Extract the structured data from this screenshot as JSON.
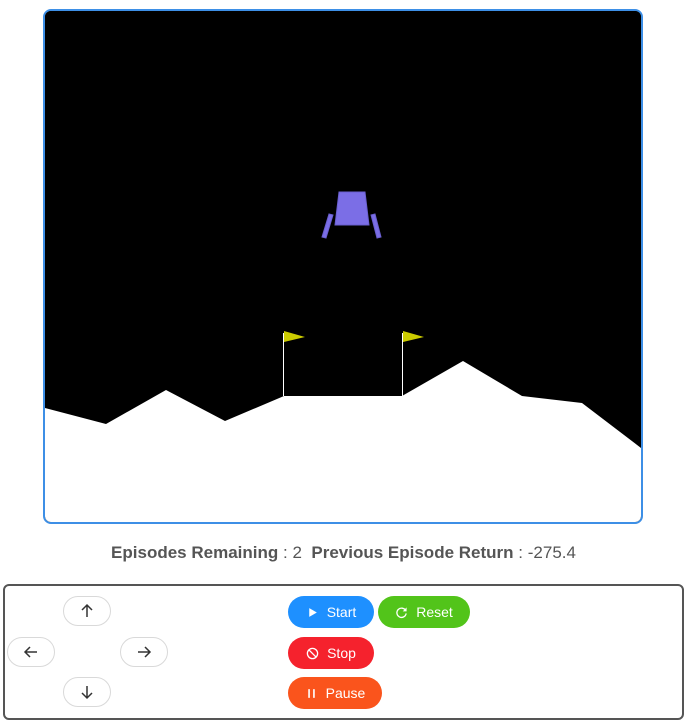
{
  "game": {
    "sky_color": "#000000",
    "ground_color": "#ffffff",
    "lander_color": "#7b6ee6",
    "flag_color": "#cccc00"
  },
  "stats": {
    "episodes_label": "Episodes Remaining",
    "episodes_value": "2",
    "return_label": "Previous Episode Return",
    "return_value": "-275.4",
    "separator": ":"
  },
  "controls": {
    "arrows": {
      "up": "arrow-up-icon",
      "left": "arrow-left-icon",
      "right": "arrow-right-icon",
      "down": "arrow-down-icon"
    },
    "start_label": "Start",
    "reset_label": "Reset",
    "stop_label": "Stop",
    "pause_label": "Pause",
    "colors": {
      "start": "#1e90ff",
      "reset": "#52c41a",
      "stop": "#f5222d",
      "pause": "#fa541c"
    }
  }
}
